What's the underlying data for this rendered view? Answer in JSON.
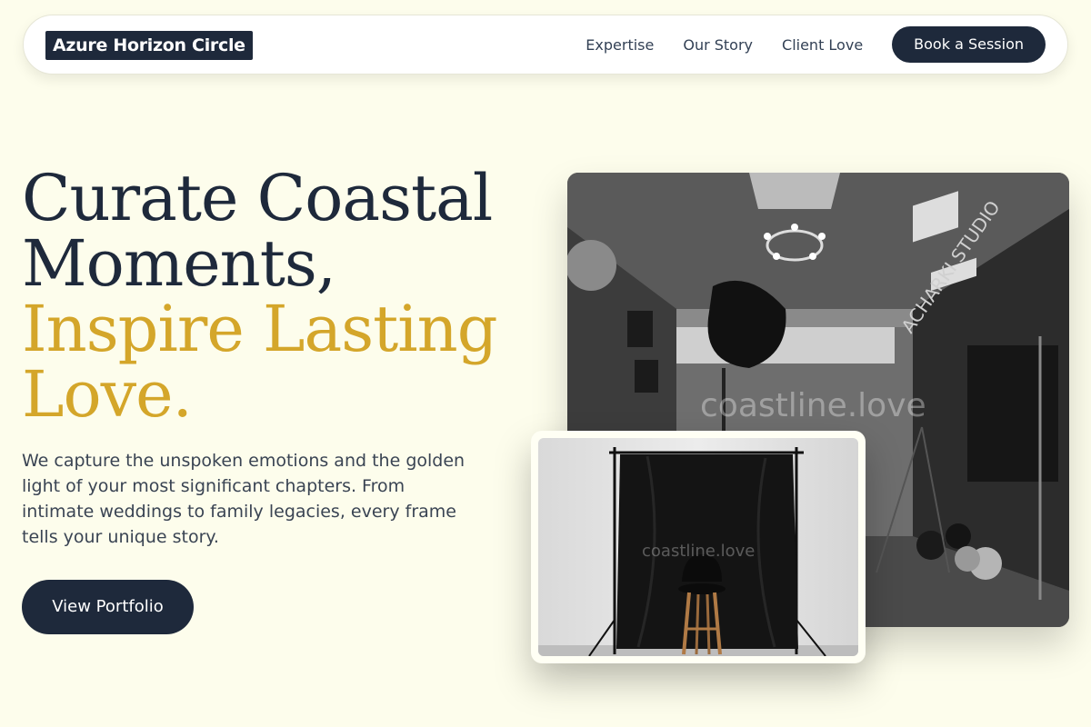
{
  "nav": {
    "logo": "Azure Horizon Circle",
    "links": [
      "Expertise",
      "Our Story",
      "Client Love"
    ],
    "cta": "Book a Session"
  },
  "hero": {
    "title_line1": "Curate Coastal",
    "title_line2": "Moments,",
    "title_line3": "Inspire Lasting",
    "title_line4": "Love.",
    "subtitle": "We capture the unspoken emotions and the golden light of your most significant chapters. From intimate weddings to family legacies, every frame tells your unique story.",
    "button": "View Portfolio"
  },
  "images": {
    "main_watermark": "coastline.love",
    "main_sign_text": "ACHARKI STUDIO",
    "sub_watermark": "coastline.love"
  },
  "colors": {
    "background": "#fdfdec",
    "navy": "#1e293b",
    "gold": "#d4a62a"
  }
}
